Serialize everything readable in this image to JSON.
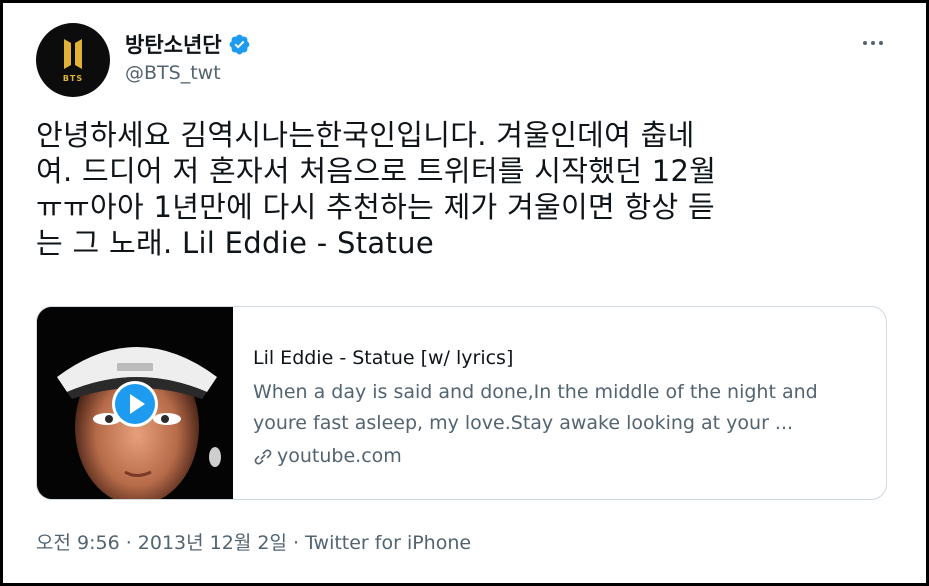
{
  "user": {
    "display_name": "방탄소년단",
    "handle": "@BTS_twt",
    "verified": true,
    "avatar_logo_text": "BTS"
  },
  "tweet": {
    "text_lines": [
      "안녕하세요 김역시나는한국인입니다. 겨울인데여 춥네",
      "여. 드디어 저 혼자서 처음으로 트위터를 시작했던 12월",
      "ㅠㅠ아아 1년만에 다시 추천하는 제가 겨울이면 항상 듣",
      "는 그 노래. Lil Eddie - Statue"
    ]
  },
  "card": {
    "title": "Lil Eddie - Statue [w/ lyrics]",
    "description_lines": [
      "When a day is said and done,In the middle of the night and",
      "youre fast asleep, my love.Stay awake looking at your ..."
    ],
    "domain": "youtube.com"
  },
  "meta": {
    "time": "오전 9:56",
    "separator1": " · ",
    "date": "2013년 12월 2일",
    "separator2": " · ",
    "source": "Twitter for iPhone"
  },
  "colors": {
    "text": "#0f1419",
    "secondary": "#536471",
    "verified_blue": "#1d9bf0",
    "border": "#cfd9de",
    "avatar_gold": "#e0b338"
  },
  "icons": {
    "verified": "verified-badge-icon",
    "more": "more-dots-icon",
    "play": "play-icon",
    "link": "link-icon"
  }
}
